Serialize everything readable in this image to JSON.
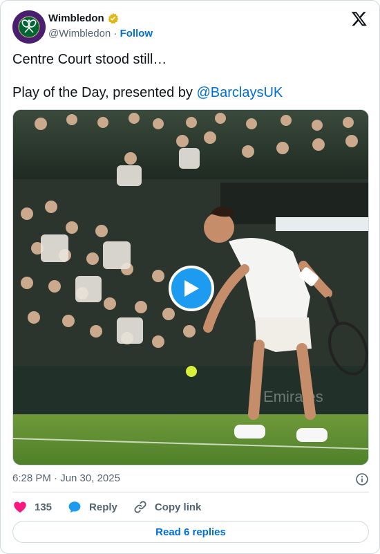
{
  "author": {
    "display_name": "Wimbledon",
    "handle": "@Wimbledon",
    "separator": "·",
    "follow_label": "Follow",
    "avatar_text": "THE CHAMPIONSHIPS WIMBLEDON"
  },
  "tweet": {
    "line1": "Centre Court stood still…",
    "line2_prefix": "Play of the Day, presented by ",
    "line2_mention": "@BarclaysUK"
  },
  "media": {
    "type": "video",
    "scene_caption_text": "Emirates",
    "play_icon": "play-icon"
  },
  "meta": {
    "timestamp": "6:28 PM · Jun 30, 2025"
  },
  "actions": {
    "like_count": "135",
    "reply_label": "Reply",
    "copy_label": "Copy link"
  },
  "footer": {
    "read_replies_label": "Read 6 replies"
  },
  "colors": {
    "link": "#006fd6",
    "like": "#f91880",
    "reply": "#1d9bf0",
    "brand_purple": "#4b1f6f",
    "brand_green": "#006633"
  }
}
